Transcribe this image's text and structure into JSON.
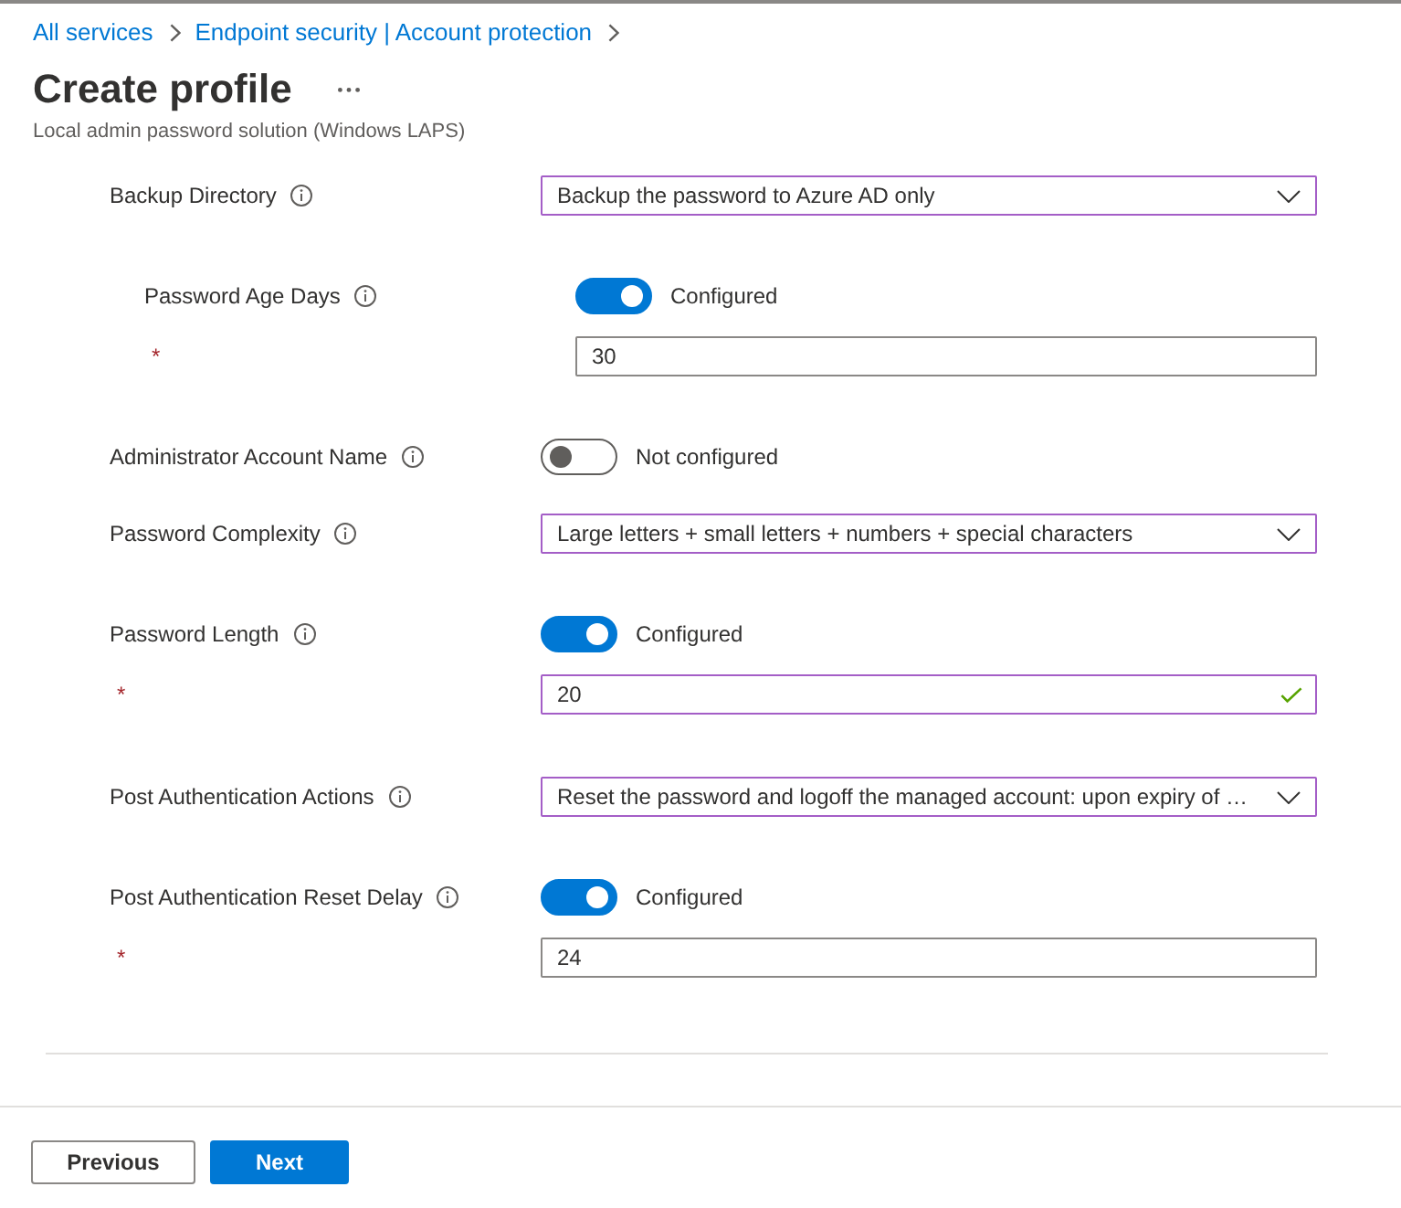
{
  "breadcrumb": [
    {
      "label": "All services"
    },
    {
      "label": "Endpoint security | Account protection"
    }
  ],
  "title": "Create profile",
  "subtitle": "Local admin password solution (Windows LAPS)",
  "settings": [
    {
      "kind": "dropdown",
      "label": "Backup Directory",
      "value": "Backup the password to Azure AD only",
      "children": [
        {
          "kind": "toggle",
          "label": "Password Age Days",
          "on": true,
          "status": "Configured",
          "field": {
            "required_mark": "*",
            "value": "30",
            "validated": false
          }
        }
      ]
    },
    {
      "kind": "toggle",
      "label": "Administrator Account Name",
      "on": false,
      "status": "Not configured"
    },
    {
      "kind": "dropdown",
      "label": "Password Complexity",
      "value": "Large letters + small letters + numbers + special characters"
    },
    {
      "kind": "toggle",
      "label": "Password Length",
      "on": true,
      "status": "Configured",
      "field": {
        "required_mark": "*",
        "value": "20",
        "validated": true
      }
    },
    {
      "kind": "dropdown",
      "label": "Post Authentication Actions",
      "value": "Reset the password and logoff the managed account: upon expiry of …"
    },
    {
      "kind": "toggle",
      "label": "Post Authentication Reset Delay",
      "on": true,
      "status": "Configured",
      "field": {
        "required_mark": "*",
        "value": "24",
        "validated": false
      }
    }
  ],
  "buttons": [
    {
      "label": "Previous",
      "kind": "secondary"
    },
    {
      "label": "Next",
      "kind": "primary"
    }
  ]
}
